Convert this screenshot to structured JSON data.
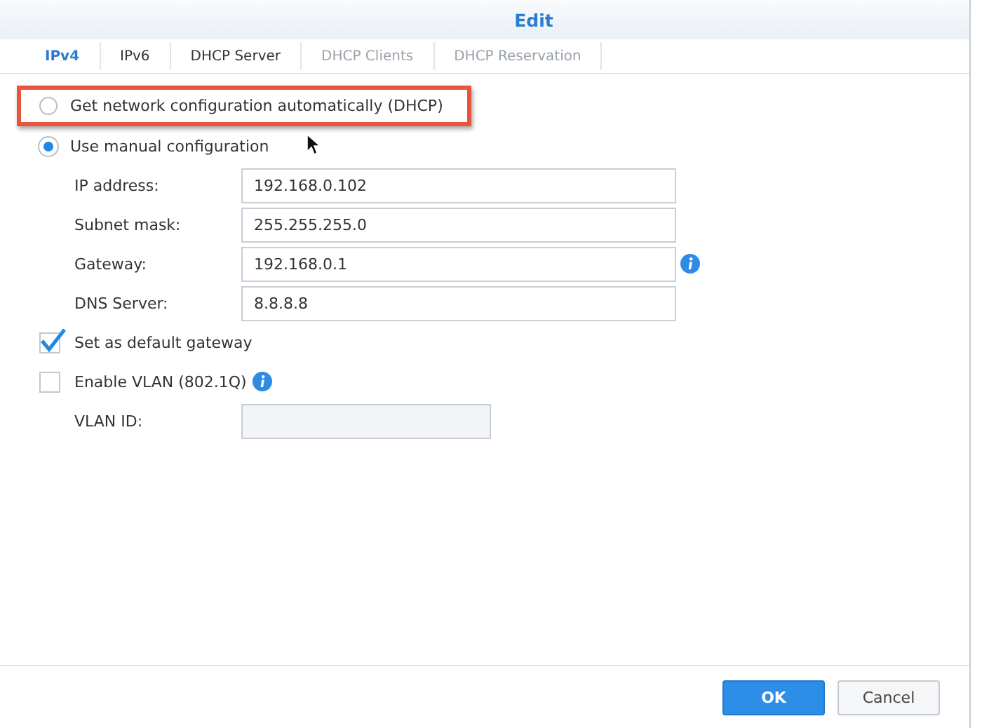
{
  "window": {
    "title": "Edit"
  },
  "tabs": [
    {
      "label": "IPv4",
      "selected": true,
      "disabled": false
    },
    {
      "label": "IPv6",
      "selected": false,
      "disabled": false
    },
    {
      "label": "DHCP Server",
      "selected": false,
      "disabled": false
    },
    {
      "label": "DHCP Clients",
      "selected": false,
      "disabled": true
    },
    {
      "label": "DHCP Reservation",
      "selected": false,
      "disabled": true
    }
  ],
  "modes": [
    {
      "label": "Get network configuration automatically (DHCP)",
      "selected": false,
      "highlighted": true
    },
    {
      "label": "Use manual configuration",
      "selected": true,
      "highlighted": false
    }
  ],
  "fields": [
    {
      "label": "IP address:",
      "value": "192.168.0.102",
      "info": false
    },
    {
      "label": "Subnet mask:",
      "value": "255.255.255.0",
      "info": false
    },
    {
      "label": "Gateway:",
      "value": "192.168.0.1",
      "info": true
    },
    {
      "label": "DNS Server:",
      "value": "8.8.8.8",
      "info": false
    }
  ],
  "options": [
    {
      "label": "Set as default gateway",
      "checked": true,
      "info": false
    },
    {
      "label": "Enable VLAN (802.1Q)",
      "checked": false,
      "info": true
    }
  ],
  "vlan_field": {
    "label": "VLAN ID:",
    "disabled": true
  },
  "buttons": [
    {
      "label": "OK",
      "kind": "primary"
    },
    {
      "label": "Cancel",
      "kind": "secondary"
    }
  ]
}
